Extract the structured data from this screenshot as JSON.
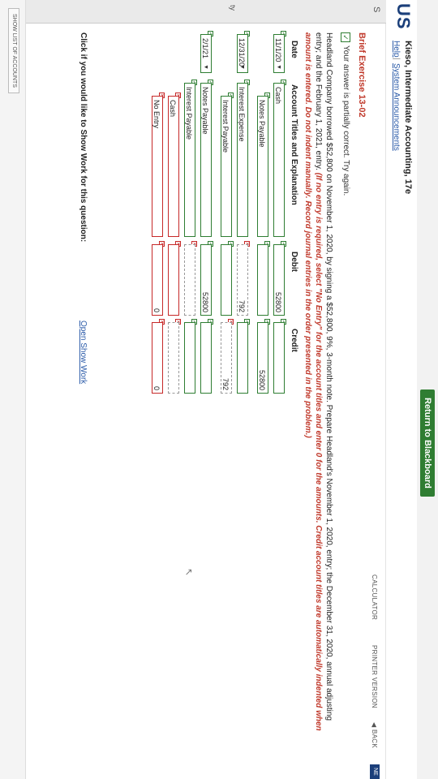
{
  "topbar": {
    "return_label": "Return to Blackboard"
  },
  "header": {
    "brand": "US",
    "course_title": "Kieso, Intermediate Accounting, 17e",
    "help": "Help",
    "separator": "|",
    "system_announcements": "System Announcements"
  },
  "sidebar": {
    "letter": "S",
    "partial": "ty"
  },
  "toolbar": {
    "calculator": "CALCULATOR",
    "printer": "PRINTER VERSION",
    "back": "◀ BACK",
    "next": "NE"
  },
  "exercise": {
    "title": "Brief Exercise 13-02",
    "status": "Your answer is partially correct.  Try again.",
    "problem_plain": "Headland Company borrowed $52,800 on November 1, 2020, by signing a $52,800, 9%, 3-month note. Prepare Headland's November 1, 2020, entry; the December 31, 2020, annual adjusting entry; and the February 1, 2021, entry.",
    "problem_emphasis": "(If no entry is required, select \"No Entry\" for the account titles and enter 0 for the amounts. Credit account titles are automatically indented when amount is entered. Do not indent manually. Record journal entries in the order presented in the problem.)"
  },
  "columns": {
    "date": "Date",
    "account": "Account Titles and Explanation",
    "debit": "Debit",
    "credit": "Credit"
  },
  "entries": {
    "e1": {
      "date": "11/1/20",
      "r1": {
        "account": "Cash",
        "debit": "52800",
        "credit": ""
      },
      "r2": {
        "account": "Notes Payable",
        "debit": "",
        "credit": "52800"
      }
    },
    "e2": {
      "date": "12/31/20",
      "r1": {
        "account": "Interest Expense",
        "debit": "792",
        "credit": ""
      },
      "r2": {
        "account": "Interest Payable",
        "debit": "",
        "credit": "792"
      }
    },
    "e3": {
      "date": "2/1/21",
      "r1": {
        "account": "Notes Payable",
        "debit": "52800",
        "credit": ""
      },
      "r2": {
        "account": "Interest Payable",
        "debit": "",
        "credit": ""
      },
      "r3": {
        "account": "Cash",
        "debit": "",
        "credit": ""
      },
      "r4": {
        "account": "No Entry",
        "debit": "0",
        "credit": "0"
      }
    }
  },
  "footer": {
    "prompt": "Click if you would like to Show Work for this question:",
    "show_work_link": "Open Show Work",
    "show_list": "SHOW LIST OF ACCOUNTS"
  },
  "marks": {
    "ok": "✓",
    "x": "✕",
    "arrow": "▼",
    "cursor": "↖"
  },
  "colors": {
    "correct": "#2e7d32",
    "incorrect": "#c62828",
    "brand": "#1b3f7a",
    "button": "#2f7d32"
  }
}
